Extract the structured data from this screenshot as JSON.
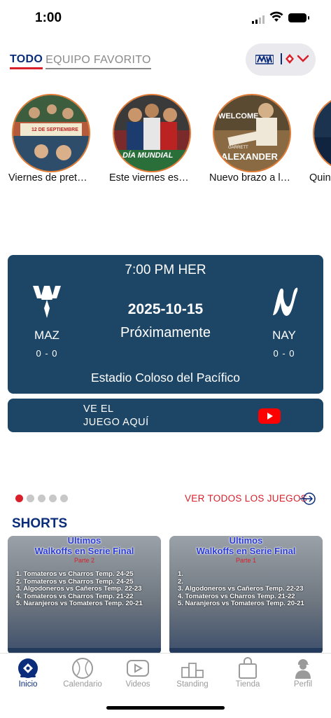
{
  "status_bar": {
    "time": "1:00"
  },
  "tabs": {
    "all": "TODO",
    "favorite": "EQUIPO FAVORITO"
  },
  "stories": [
    {
      "label": "Viernes de pret…",
      "image_caption": "12 DE SEPTIEMBRE"
    },
    {
      "label": "Este viernes es…",
      "image_caption": "DÍA MUNDIAL"
    },
    {
      "label": "Nuevo brazo a l…",
      "image_caption_top": "WELCOME",
      "image_caption_small": "GARRETT",
      "image_caption_big": "ALEXANDER"
    },
    {
      "label": "Quin"
    }
  ],
  "game": {
    "time": "7:00 PM HER",
    "date": "2025-10-15",
    "status": "Próximamente",
    "stadium": "Estadio Coloso del Pacífico",
    "home": {
      "abbr": "MAZ",
      "record": "0 - 0"
    },
    "away": {
      "abbr": "NAY",
      "record": "0 - 0"
    }
  },
  "watch": {
    "line1": "VE EL",
    "line2": "JUEGO AQUÍ"
  },
  "carousel": {
    "count": 5,
    "active": 0
  },
  "see_all_games": "VER TODOS LOS JUEGOS",
  "shorts": {
    "title": "SHORTS",
    "items": [
      {
        "title1": "Ultimos",
        "title2": "Walkoffs en Serie Final",
        "part": "Parte 2",
        "lines": [
          "1. Tomateros vs Charros Temp. 24-25",
          "2. Tomateros vs Charros Temp. 24-25",
          "3. Algodoneros vs Cañeros Temp. 22-23",
          "4. Tomateros vs Charros Temp. 21-22",
          "5. Naranjeros vs Tomateros Temp. 20-21"
        ]
      },
      {
        "title1": "Ultimos",
        "title2": "Walkoffs en Serie Final",
        "part": "Parte 1",
        "lines": [
          "1.",
          "2.",
          "3. Algodoneros vs Cañeros Temp. 22-23",
          "4. Tomateros vs Charros Temp. 21-22",
          "5. Naranjeros vs Tomateros Temp. 20-21"
        ]
      }
    ]
  },
  "tabbar": [
    {
      "label": "Inicio",
      "icon": "baseball-field-icon",
      "active": true
    },
    {
      "label": "Calendario",
      "icon": "baseball-icon"
    },
    {
      "label": "Videos",
      "icon": "video-play-icon"
    },
    {
      "label": "Standing",
      "icon": "podium-icon"
    },
    {
      "label": "Tienda",
      "icon": "shopping-bag-icon"
    },
    {
      "label": "Perfil",
      "icon": "player-profile-icon"
    }
  ],
  "colors": {
    "navy": "#1c4566",
    "brand_blue": "#0b2c7a",
    "accent_red": "#d81f2a",
    "story_ring": "#e07a34"
  }
}
